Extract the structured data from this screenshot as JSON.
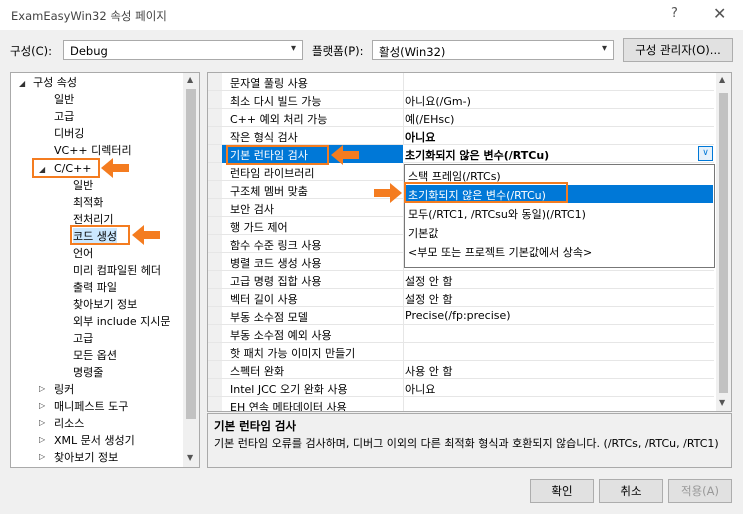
{
  "window": {
    "title": "ExamEasyWin32 속성 페이지",
    "help": "?",
    "close": "✕"
  },
  "config": {
    "label": "구성(C):",
    "value": "Debug"
  },
  "platform": {
    "label": "플랫폼(P):",
    "value": "활성(Win32)"
  },
  "config_manager": "구성 관리자(O)...",
  "tree": {
    "root": "구성 속성",
    "items": [
      "일반",
      "고급",
      "디버깅",
      "VC++ 디렉터리",
      "C/C++",
      "일반",
      "최적화",
      "전처리기",
      "코드 생성",
      "언어",
      "미리 컴파일된 헤더",
      "출력 파일",
      "찾아보기 정보",
      "외부 include 지시문",
      "고급",
      "모든 옵션",
      "명령줄",
      "링커",
      "매니페스트 도구",
      "리소스",
      "XML 문서 생성기",
      "찾아보기 정보"
    ]
  },
  "grid": {
    "rows": [
      {
        "name": "문자열 풀링 사용",
        "value": ""
      },
      {
        "name": "최소 다시 빌드 가능",
        "value": "아니요(/Gm-)"
      },
      {
        "name": "C++ 예외 처리 가능",
        "value": "예(/EHsc)"
      },
      {
        "name": "작은 형식 검사",
        "value": "아니요"
      },
      {
        "name": "기본 런타임 검사",
        "value": "초기화되지 않은 변수(/RTCu)"
      },
      {
        "name": "런타임 라이브러리",
        "value": ""
      },
      {
        "name": "구조체 멤버 맞춤",
        "value": ""
      },
      {
        "name": "보안 검사",
        "value": ""
      },
      {
        "name": "행 가드 제어",
        "value": ""
      },
      {
        "name": "함수 수준 링크 사용",
        "value": ""
      },
      {
        "name": "병렬 코드 생성 사용",
        "value": ""
      },
      {
        "name": "고급 명령 집합 사용",
        "value": "설정 안 함"
      },
      {
        "name": "벡터 길이 사용",
        "value": "설정 안 함"
      },
      {
        "name": "부동 소수점 모델",
        "value": "Precise(/fp:precise)"
      },
      {
        "name": "부동 소수점 예외 사용",
        "value": ""
      },
      {
        "name": "핫 패치 가능 이미지 만들기",
        "value": ""
      },
      {
        "name": "스펙터 완화",
        "value": "사용 안 함"
      },
      {
        "name": "Intel JCC 오기 완화 사용",
        "value": "아니요"
      },
      {
        "name": "EH 연속 메타데이터 사용",
        "value": ""
      }
    ]
  },
  "dropdown": {
    "options": [
      "스택 프레임(/RTCs)",
      "초기화되지 않은 변수(/RTCu)",
      "모두(/RTC1, /RTCsu와 동일)(/RTC1)",
      "기본값",
      "<부모 또는 프로젝트 기본값에서 상속>"
    ]
  },
  "description": {
    "title": "기본 런타임 검사",
    "text": "기본 런타임 오류를 검사하며, 디버그 이외의 다른 최적화 형식과 호환되지 않습니다.      (/RTCs, /RTCu, /RTC1)"
  },
  "buttons": {
    "ok": "확인",
    "cancel": "취소",
    "apply": "적용(A)"
  },
  "colors": {
    "accent": "#0078d7",
    "highlight_box": "#f47c20",
    "selection": "#0078d7"
  }
}
